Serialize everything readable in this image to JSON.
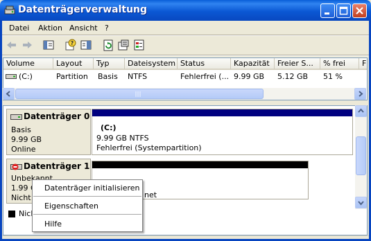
{
  "window": {
    "title": "Datenträgerverwaltung",
    "icon": "disk-management-icon",
    "controls": [
      "minimize-icon",
      "maximize-icon",
      "close-icon"
    ]
  },
  "menu": [
    "Datei",
    "Aktion",
    "Ansicht",
    "?"
  ],
  "toolbar": [
    "back-arrow-icon",
    "forward-arrow-icon",
    "show-hide-tree-icon",
    "help-properties-icon",
    "view-icon",
    "refresh-icon",
    "properties-icon",
    "settings-icon"
  ],
  "volume_list": {
    "columns": [
      "Volume",
      "Layout",
      "Typ",
      "Dateisystem",
      "Status",
      "Kapazität",
      "Freier S...",
      "% frei",
      "F"
    ],
    "rows": [
      {
        "volume": "(C:)",
        "layout": "Partition",
        "typ": "Basis",
        "dateisystem": "NTFS",
        "status": "Fehlerfrei (...",
        "kapazitaet": "9.99 GB",
        "frei": "5.12 GB",
        "prozent": "51 %"
      }
    ]
  },
  "disks": [
    {
      "name": "Datenträger 0",
      "type": "Basis",
      "size": "9.99 GB",
      "status": "Online",
      "volume": {
        "label": "(C:)",
        "detail": "9.99 GB NTFS",
        "status": "Fehlerfrei (Systempartition)"
      }
    },
    {
      "name": "Datenträger 1",
      "type": "Unbekannt",
      "size_partial": "1.99 G",
      "status_partial": "Nicht i",
      "volume_partial": "net"
    }
  ],
  "legend": {
    "partial_label": "Nich"
  },
  "context_menu": [
    "Datenträger initialisieren",
    "Eigenschaften",
    "Hilfe"
  ],
  "colors": {
    "title_bar": "#0a5fd8",
    "primary_partition": "#000080",
    "unallocated": "#000000",
    "window_bg": "#ece9d8"
  }
}
